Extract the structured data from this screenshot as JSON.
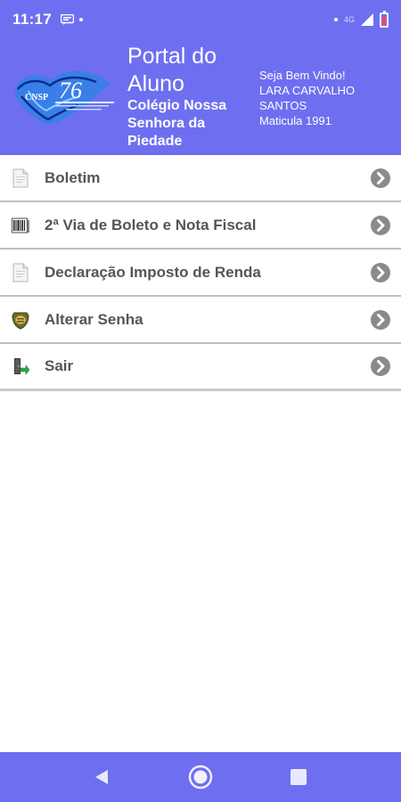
{
  "status_bar": {
    "time": "11:17",
    "network": "4G"
  },
  "header": {
    "title": "Portal do Aluno",
    "school": "Colégio Nossa Senhora da Piedade",
    "welcome": "Seja Bem Vindo!",
    "student_name": "LARA CARVALHO SANTOS",
    "enrollment": "Maticula 1991",
    "logo_icon": "school-logo-icon"
  },
  "menu": {
    "items": [
      {
        "label": "Boletim",
        "icon": "document-icon"
      },
      {
        "label": "2ª Via de Boleto e Nota Fiscal",
        "icon": "barcode-icon"
      },
      {
        "label": "Declaração Imposto de Renda",
        "icon": "document-icon"
      },
      {
        "label": "Alterar Senha",
        "icon": "badge-icon"
      },
      {
        "label": "Sair",
        "icon": "exit-icon"
      }
    ]
  },
  "colors": {
    "primary": "#6e6ff0",
    "text": "#555555",
    "chevron": "#8a8a8a",
    "divider": "#bfbfbf"
  }
}
